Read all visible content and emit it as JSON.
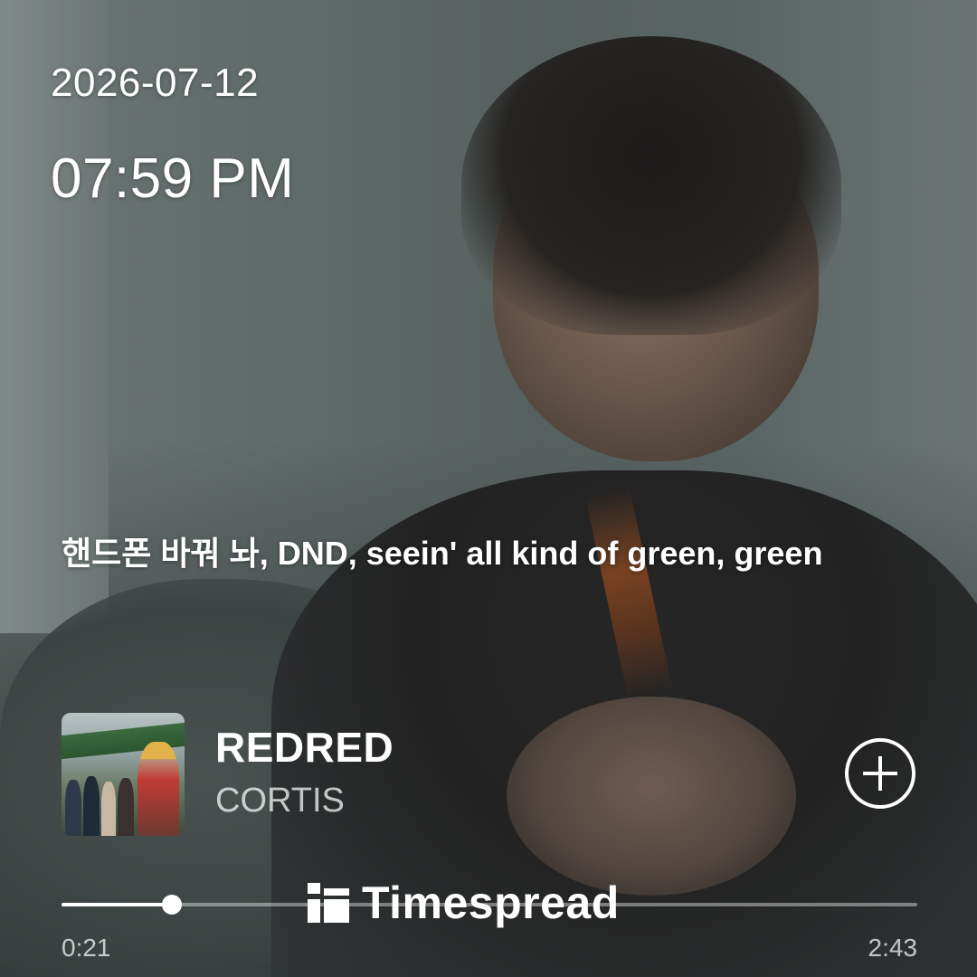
{
  "header": {
    "date": "2026-07-12",
    "time": "07:59 PM"
  },
  "lyric": {
    "text": "핸드폰 바꿔 놔, DND, seein' all kind of green, green"
  },
  "track": {
    "title": "REDRED",
    "artist": "CORTIS",
    "add_icon": "plus-circle-icon"
  },
  "playback": {
    "elapsed": "0:21",
    "total": "2:43",
    "progress_fraction": 0.129
  },
  "watermark": {
    "brand": "Timespread"
  },
  "colors": {
    "text": "#ffffff",
    "muted_text": "#ffffffb8",
    "track_bg": "#ffffff66"
  }
}
